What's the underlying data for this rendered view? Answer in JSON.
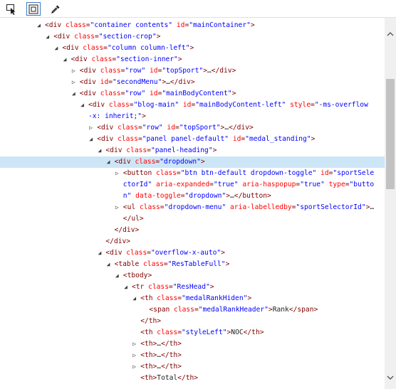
{
  "toolbar": {
    "buttons": [
      {
        "name": "select-element-button",
        "icon": "select-element-icon",
        "active": false
      },
      {
        "name": "highlight-element-button",
        "icon": "highlight-box-icon",
        "active": true
      },
      {
        "name": "color-picker-button",
        "icon": "eyedropper-icon",
        "active": false
      }
    ]
  },
  "colors": {
    "tag": "#800000",
    "attribute_name": "#ff0000",
    "attribute_value": "#0000ff",
    "text": "#1e1e1e",
    "selected_row": "#cde6f7"
  },
  "tree": [
    {
      "indent": 0,
      "caret": "open",
      "parts": [
        {
          "t": "tag",
          "v": "<div "
        },
        {
          "t": "attr",
          "v": "class"
        },
        {
          "t": "tag",
          "v": "="
        },
        {
          "t": "val",
          "v": "\"container contents\""
        },
        {
          "t": "plain",
          "v": " "
        },
        {
          "t": "attr",
          "v": "id"
        },
        {
          "t": "tag",
          "v": "="
        },
        {
          "t": "val",
          "v": "\"mainContainer\""
        },
        {
          "t": "tag",
          "v": ">"
        }
      ]
    },
    {
      "indent": 1,
      "caret": "open",
      "parts": [
        {
          "t": "tag",
          "v": "<div "
        },
        {
          "t": "attr",
          "v": "class"
        },
        {
          "t": "tag",
          "v": "="
        },
        {
          "t": "val",
          "v": "\"section-crop\""
        },
        {
          "t": "tag",
          "v": ">"
        }
      ]
    },
    {
      "indent": 2,
      "caret": "open",
      "parts": [
        {
          "t": "tag",
          "v": "<div "
        },
        {
          "t": "attr",
          "v": "class"
        },
        {
          "t": "tag",
          "v": "="
        },
        {
          "t": "val",
          "v": "\"column column-left\""
        },
        {
          "t": "tag",
          "v": ">"
        }
      ]
    },
    {
      "indent": 3,
      "caret": "open",
      "parts": [
        {
          "t": "tag",
          "v": "<div "
        },
        {
          "t": "attr",
          "v": "class"
        },
        {
          "t": "tag",
          "v": "="
        },
        {
          "t": "val",
          "v": "\"section-inner\""
        },
        {
          "t": "tag",
          "v": ">"
        }
      ]
    },
    {
      "indent": 4,
      "caret": "closed",
      "parts": [
        {
          "t": "tag",
          "v": "<div "
        },
        {
          "t": "attr",
          "v": "class"
        },
        {
          "t": "tag",
          "v": "="
        },
        {
          "t": "val",
          "v": "\"row\""
        },
        {
          "t": "plain",
          "v": " "
        },
        {
          "t": "attr",
          "v": "id"
        },
        {
          "t": "tag",
          "v": "="
        },
        {
          "t": "val",
          "v": "\"topSport\""
        },
        {
          "t": "tag",
          "v": ">"
        },
        {
          "t": "plain",
          "v": "…"
        },
        {
          "t": "tag",
          "v": "</div>"
        }
      ]
    },
    {
      "indent": 4,
      "caret": "closed",
      "parts": [
        {
          "t": "tag",
          "v": "<div "
        },
        {
          "t": "attr",
          "v": "id"
        },
        {
          "t": "tag",
          "v": "="
        },
        {
          "t": "val",
          "v": "\"secondMenu\""
        },
        {
          "t": "tag",
          "v": ">"
        },
        {
          "t": "plain",
          "v": "…"
        },
        {
          "t": "tag",
          "v": "</div>"
        }
      ]
    },
    {
      "indent": 4,
      "caret": "open",
      "parts": [
        {
          "t": "tag",
          "v": "<div "
        },
        {
          "t": "attr",
          "v": "class"
        },
        {
          "t": "tag",
          "v": "="
        },
        {
          "t": "val",
          "v": "\"row\""
        },
        {
          "t": "plain",
          "v": " "
        },
        {
          "t": "attr",
          "v": "id"
        },
        {
          "t": "tag",
          "v": "="
        },
        {
          "t": "val",
          "v": "\"mainBodyContent\""
        },
        {
          "t": "tag",
          "v": ">"
        }
      ]
    },
    {
      "indent": 5,
      "caret": "open",
      "parts": [
        {
          "t": "tag",
          "v": "<div "
        },
        {
          "t": "attr",
          "v": "class"
        },
        {
          "t": "tag",
          "v": "="
        },
        {
          "t": "val",
          "v": "\"blog-main\""
        },
        {
          "t": "plain",
          "v": " "
        },
        {
          "t": "attr",
          "v": "id"
        },
        {
          "t": "tag",
          "v": "="
        },
        {
          "t": "val",
          "v": "\"mainBodyContent-left\""
        },
        {
          "t": "plain",
          "v": " "
        },
        {
          "t": "attr",
          "v": "style"
        },
        {
          "t": "tag",
          "v": "="
        },
        {
          "t": "val",
          "v": "\"-ms-overflow"
        }
      ]
    },
    {
      "indent": 5,
      "caret": "none",
      "cont": true,
      "parts": [
        {
          "t": "val",
          "v": "-x: inherit;\""
        },
        {
          "t": "tag",
          "v": ">"
        }
      ]
    },
    {
      "indent": 6,
      "caret": "closed",
      "parts": [
        {
          "t": "tag",
          "v": "<div "
        },
        {
          "t": "attr",
          "v": "class"
        },
        {
          "t": "tag",
          "v": "="
        },
        {
          "t": "val",
          "v": "\"row\""
        },
        {
          "t": "plain",
          "v": " "
        },
        {
          "t": "attr",
          "v": "id"
        },
        {
          "t": "tag",
          "v": "="
        },
        {
          "t": "val",
          "v": "\"topSport\""
        },
        {
          "t": "tag",
          "v": ">"
        },
        {
          "t": "plain",
          "v": "…"
        },
        {
          "t": "tag",
          "v": "</div>"
        }
      ]
    },
    {
      "indent": 6,
      "caret": "open",
      "parts": [
        {
          "t": "tag",
          "v": "<div "
        },
        {
          "t": "attr",
          "v": "class"
        },
        {
          "t": "tag",
          "v": "="
        },
        {
          "t": "val",
          "v": "\"panel panel-default\""
        },
        {
          "t": "plain",
          "v": " "
        },
        {
          "t": "attr",
          "v": "id"
        },
        {
          "t": "tag",
          "v": "="
        },
        {
          "t": "val",
          "v": "\"medal_standing\""
        },
        {
          "t": "tag",
          "v": ">"
        }
      ]
    },
    {
      "indent": 7,
      "caret": "open",
      "parts": [
        {
          "t": "tag",
          "v": "<div "
        },
        {
          "t": "attr",
          "v": "class"
        },
        {
          "t": "tag",
          "v": "="
        },
        {
          "t": "val",
          "v": "\"panel-heading\""
        },
        {
          "t": "tag",
          "v": ">"
        }
      ]
    },
    {
      "indent": 8,
      "caret": "open",
      "selected": true,
      "parts": [
        {
          "t": "tag",
          "v": "<div "
        },
        {
          "t": "attr",
          "v": "class"
        },
        {
          "t": "tag",
          "v": "="
        },
        {
          "t": "val",
          "v": "\"dropdown\""
        },
        {
          "t": "tag",
          "v": ">"
        }
      ]
    },
    {
      "indent": 9,
      "caret": "closed",
      "parts": [
        {
          "t": "tag",
          "v": "<button "
        },
        {
          "t": "attr",
          "v": "class"
        },
        {
          "t": "tag",
          "v": "="
        },
        {
          "t": "val",
          "v": "\"btn btn-default dropdown-toggle\""
        },
        {
          "t": "plain",
          "v": " "
        },
        {
          "t": "attr",
          "v": "id"
        },
        {
          "t": "tag",
          "v": "="
        },
        {
          "t": "val",
          "v": "\"sportSele"
        }
      ]
    },
    {
      "indent": 9,
      "caret": "none",
      "cont": true,
      "parts": [
        {
          "t": "val",
          "v": "ctorId\""
        },
        {
          "t": "plain",
          "v": " "
        },
        {
          "t": "attr",
          "v": "aria-expanded"
        },
        {
          "t": "tag",
          "v": "="
        },
        {
          "t": "val",
          "v": "\"true\""
        },
        {
          "t": "plain",
          "v": " "
        },
        {
          "t": "attr",
          "v": "aria-haspopup"
        },
        {
          "t": "tag",
          "v": "="
        },
        {
          "t": "val",
          "v": "\"true\""
        },
        {
          "t": "plain",
          "v": " "
        },
        {
          "t": "attr",
          "v": "type"
        },
        {
          "t": "tag",
          "v": "="
        },
        {
          "t": "val",
          "v": "\"butto"
        }
      ]
    },
    {
      "indent": 9,
      "caret": "none",
      "cont": true,
      "parts": [
        {
          "t": "val",
          "v": "n\""
        },
        {
          "t": "plain",
          "v": " "
        },
        {
          "t": "attr",
          "v": "data-toggle"
        },
        {
          "t": "tag",
          "v": "="
        },
        {
          "t": "val",
          "v": "\"dropdown\""
        },
        {
          "t": "tag",
          "v": ">"
        },
        {
          "t": "plain",
          "v": "…"
        },
        {
          "t": "tag",
          "v": "</button>"
        }
      ]
    },
    {
      "indent": 9,
      "caret": "closed",
      "parts": [
        {
          "t": "tag",
          "v": "<ul "
        },
        {
          "t": "attr",
          "v": "class"
        },
        {
          "t": "tag",
          "v": "="
        },
        {
          "t": "val",
          "v": "\"dropdown-menu\""
        },
        {
          "t": "plain",
          "v": " "
        },
        {
          "t": "attr",
          "v": "aria-labelledby"
        },
        {
          "t": "tag",
          "v": "="
        },
        {
          "t": "val",
          "v": "\"sportSelectorId\""
        },
        {
          "t": "tag",
          "v": ">"
        },
        {
          "t": "plain",
          "v": "…"
        }
      ]
    },
    {
      "indent": 9,
      "caret": "none",
      "cont": true,
      "parts": [
        {
          "t": "tag",
          "v": "</ul>"
        }
      ]
    },
    {
      "indent": 8,
      "caret": "none",
      "closer": true,
      "parts": [
        {
          "t": "tag",
          "v": "</div>"
        }
      ]
    },
    {
      "indent": 7,
      "caret": "none",
      "closer": true,
      "parts": [
        {
          "t": "tag",
          "v": "</div>"
        }
      ]
    },
    {
      "indent": 7,
      "caret": "open",
      "parts": [
        {
          "t": "tag",
          "v": "<div "
        },
        {
          "t": "attr",
          "v": "class"
        },
        {
          "t": "tag",
          "v": "="
        },
        {
          "t": "val",
          "v": "\"overflow-x-auto\""
        },
        {
          "t": "tag",
          "v": ">"
        }
      ]
    },
    {
      "indent": 8,
      "caret": "open",
      "parts": [
        {
          "t": "tag",
          "v": "<table "
        },
        {
          "t": "attr",
          "v": "class"
        },
        {
          "t": "tag",
          "v": "="
        },
        {
          "t": "val",
          "v": "\"ResTableFull\""
        },
        {
          "t": "tag",
          "v": ">"
        }
      ]
    },
    {
      "indent": 9,
      "caret": "open",
      "parts": [
        {
          "t": "tag",
          "v": "<tbody>"
        }
      ]
    },
    {
      "indent": 10,
      "caret": "open",
      "parts": [
        {
          "t": "tag",
          "v": "<tr "
        },
        {
          "t": "attr",
          "v": "class"
        },
        {
          "t": "tag",
          "v": "="
        },
        {
          "t": "val",
          "v": "\"ResHead\""
        },
        {
          "t": "tag",
          "v": ">"
        }
      ]
    },
    {
      "indent": 11,
      "caret": "open",
      "parts": [
        {
          "t": "tag",
          "v": "<th "
        },
        {
          "t": "attr",
          "v": "class"
        },
        {
          "t": "tag",
          "v": "="
        },
        {
          "t": "val",
          "v": "\"medalRankHiden\""
        },
        {
          "t": "tag",
          "v": ">"
        }
      ]
    },
    {
      "indent": 12,
      "caret": "none",
      "parts": [
        {
          "t": "tag",
          "v": "<span "
        },
        {
          "t": "attr",
          "v": "class"
        },
        {
          "t": "tag",
          "v": "="
        },
        {
          "t": "val",
          "v": "\"medalRankHeader\""
        },
        {
          "t": "tag",
          "v": ">"
        },
        {
          "t": "plain",
          "v": "Rank"
        },
        {
          "t": "tag",
          "v": "</span>"
        }
      ]
    },
    {
      "indent": 11,
      "caret": "none",
      "closer": true,
      "parts": [
        {
          "t": "tag",
          "v": "</th>"
        }
      ]
    },
    {
      "indent": 11,
      "caret": "none",
      "closer": true,
      "parts": [
        {
          "t": "tag",
          "v": "<th "
        },
        {
          "t": "attr",
          "v": "class"
        },
        {
          "t": "tag",
          "v": "="
        },
        {
          "t": "val",
          "v": "\"styleLeft\""
        },
        {
          "t": "tag",
          "v": ">"
        },
        {
          "t": "plain",
          "v": "NOC"
        },
        {
          "t": "tag",
          "v": "</th>"
        }
      ]
    },
    {
      "indent": 11,
      "caret": "closed",
      "parts": [
        {
          "t": "tag",
          "v": "<th>"
        },
        {
          "t": "plain",
          "v": "…"
        },
        {
          "t": "tag",
          "v": "</th>"
        }
      ]
    },
    {
      "indent": 11,
      "caret": "closed",
      "parts": [
        {
          "t": "tag",
          "v": "<th>"
        },
        {
          "t": "plain",
          "v": "…"
        },
        {
          "t": "tag",
          "v": "</th>"
        }
      ]
    },
    {
      "indent": 11,
      "caret": "closed",
      "parts": [
        {
          "t": "tag",
          "v": "<th>"
        },
        {
          "t": "plain",
          "v": "…"
        },
        {
          "t": "tag",
          "v": "</th>"
        }
      ]
    },
    {
      "indent": 11,
      "caret": "none",
      "closer": true,
      "parts": [
        {
          "t": "tag",
          "v": "<th>"
        },
        {
          "t": "plain",
          "v": "Total"
        },
        {
          "t": "tag",
          "v": "</th>"
        }
      ]
    }
  ]
}
